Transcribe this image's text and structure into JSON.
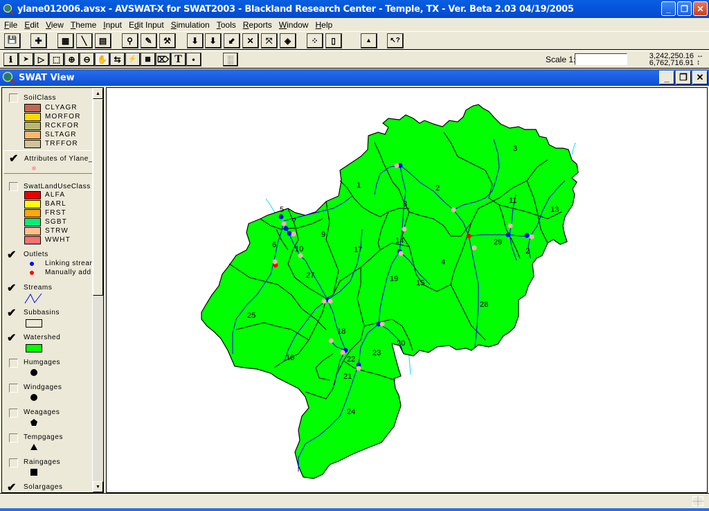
{
  "window": {
    "title": "ylane012006.avsx - AVSWAT-X for SWAT2003 - Blackland Research Center - Temple, TX - Ver. Beta 2.03 04/19/2005",
    "app_icon": "magnifier-globe-icon",
    "controls": {
      "minimize": "_",
      "maximize": "❐",
      "close": "✕"
    }
  },
  "menubar": {
    "items": [
      {
        "label": "File",
        "accel": "F"
      },
      {
        "label": "Edit",
        "accel": "E"
      },
      {
        "label": "View",
        "accel": "V"
      },
      {
        "label": "Theme",
        "accel": "T"
      },
      {
        "label": "Input",
        "accel": "I"
      },
      {
        "label": "Edit Input",
        "accel": "d"
      },
      {
        "label": "Simulation",
        "accel": "S"
      },
      {
        "label": "Tools",
        "accel": "T"
      },
      {
        "label": "Reports",
        "accel": "R"
      },
      {
        "label": "Window",
        "accel": "W"
      },
      {
        "label": "Help",
        "accel": "H"
      }
    ]
  },
  "toolbar_buttons": [
    {
      "name": "save-icon",
      "glyph": "💾"
    },
    {
      "name": "add-theme-icon",
      "glyph": "✚"
    },
    {
      "name": "theme-properties-icon",
      "glyph": "▦"
    },
    {
      "name": "edit-legend-icon",
      "glyph": "╲"
    },
    {
      "name": "open-table-icon",
      "glyph": "▤"
    },
    {
      "name": "find-icon",
      "glyph": "⚲"
    },
    {
      "name": "locate-address-icon",
      "glyph": "✎"
    },
    {
      "name": "query-builder-icon",
      "glyph": "⚒"
    },
    {
      "name": "zoom-to-full-extent-icon",
      "glyph": "⬇"
    },
    {
      "name": "zoom-to-active-themes-icon",
      "glyph": "⬇"
    },
    {
      "name": "zoom-to-selected-icon",
      "glyph": "⬋"
    },
    {
      "name": "zoom-in-fixed-icon",
      "glyph": "✕"
    },
    {
      "name": "zoom-out-fixed-icon",
      "glyph": "⤧"
    },
    {
      "name": "zoom-previous-icon",
      "glyph": "◈"
    },
    {
      "name": "select-by-theme-icon",
      "glyph": "⁘"
    },
    {
      "name": "clear-selection-icon",
      "glyph": "▯"
    },
    {
      "name": "create-chart-icon",
      "glyph": "▲"
    },
    {
      "name": "help-pointer-icon",
      "glyph": "↖?"
    }
  ],
  "tool_buttons": [
    {
      "name": "identify-icon",
      "glyph": "ℹ"
    },
    {
      "name": "pointer-icon",
      "glyph": "➤"
    },
    {
      "name": "vertex-edit-icon",
      "glyph": "▷"
    },
    {
      "name": "select-feature-icon",
      "glyph": "⬚"
    },
    {
      "name": "zoom-in-icon",
      "glyph": "⊕"
    },
    {
      "name": "zoom-out-icon",
      "glyph": "⊖"
    },
    {
      "name": "pan-icon",
      "glyph": "✋"
    },
    {
      "name": "measure-icon",
      "glyph": "⇆"
    },
    {
      "name": "hot-link-icon",
      "glyph": "⚡"
    },
    {
      "name": "area-of-interest-icon",
      "glyph": "▩"
    },
    {
      "name": "label-icon",
      "glyph": "⌦"
    },
    {
      "name": "text-icon",
      "glyph": "T"
    },
    {
      "name": "draw-point-icon",
      "glyph": "•"
    },
    {
      "name": "snap-icon",
      "glyph": "░"
    }
  ],
  "scale": {
    "label": "Scale 1:",
    "value": ""
  },
  "coordinates": {
    "x": "3,242,250.16",
    "y": "6,762,716.91",
    "x_arrow": "↔",
    "y_arrow": "↕"
  },
  "view": {
    "title": "SWAT View",
    "icon": "view-globe-icon"
  },
  "toc": {
    "themes": [
      {
        "name": "SoilClass",
        "checked": false,
        "legend": [
          {
            "label": "CLYAGR",
            "color": "#c06850"
          },
          {
            "label": "MORFOR",
            "color": "#ffd800"
          },
          {
            "label": "RCKFOR",
            "color": "#bab870"
          },
          {
            "label": "SLTAGR",
            "color": "#f8b870"
          },
          {
            "label": "TRFFOR",
            "color": "#d0c498"
          }
        ]
      },
      {
        "name": "Attributes of Ylane_",
        "checked": true,
        "active": true,
        "symbol": {
          "type": "dot",
          "color": "#f8a8a8"
        }
      },
      {
        "name": "SwatLandUseClass",
        "checked": false,
        "legend": [
          {
            "label": "ALFA",
            "color": "#e80000"
          },
          {
            "label": "BARL",
            "color": "#ffff00"
          },
          {
            "label": "FRST",
            "color": "#ffa800"
          },
          {
            "label": "SGBT",
            "color": "#00f070"
          },
          {
            "label": "STRW",
            "color": "#ffc090"
          },
          {
            "label": "WWHT",
            "color": "#ff7070"
          }
        ]
      },
      {
        "name": "Outlets",
        "checked": true,
        "legend": [
          {
            "label": "Linking strear",
            "color": "#0000ff",
            "type": "dot"
          },
          {
            "label": "Manually add",
            "color": "#ff0000",
            "type": "dot"
          }
        ]
      },
      {
        "name": "Streams",
        "checked": true,
        "symbol": {
          "type": "line",
          "color": "#0000ff"
        }
      },
      {
        "name": "Subbasins",
        "checked": true,
        "symbol": {
          "type": "box",
          "color": "#ece9d8"
        }
      },
      {
        "name": "Watershed",
        "checked": true,
        "symbol": {
          "type": "box",
          "color": "#00ff00"
        }
      },
      {
        "name": "Humgages",
        "checked": false,
        "symbol": {
          "type": "circle"
        }
      },
      {
        "name": "Windgages",
        "checked": false,
        "symbol": {
          "type": "circle"
        }
      },
      {
        "name": "Weagages",
        "checked": false,
        "symbol": {
          "type": "pentagon"
        }
      },
      {
        "name": "Tempgages",
        "checked": false,
        "symbol": {
          "type": "triangle"
        }
      },
      {
        "name": "Raingages",
        "checked": false,
        "symbol": {
          "type": "square"
        }
      },
      {
        "name": "Solargages",
        "checked": true
      }
    ]
  },
  "map": {
    "colors": {
      "watershed": "#00ff00",
      "boundary": "#000000",
      "stream": "#0000ff",
      "stream_outside": "#00e0ff",
      "linking_outlet": "#0000ff",
      "manual_outlet": "#ff0000",
      "attribute_point": "#f8b0b0"
    },
    "subbasin_labels": [
      "1",
      "2",
      "3",
      "4",
      "5",
      "6",
      "7",
      "8",
      "9",
      "10",
      "11",
      "13",
      "14",
      "15",
      "16",
      "17",
      "18",
      "19",
      "20",
      "21",
      "22",
      "23",
      "24",
      "25",
      "27",
      "28",
      "29",
      "2"
    ]
  }
}
